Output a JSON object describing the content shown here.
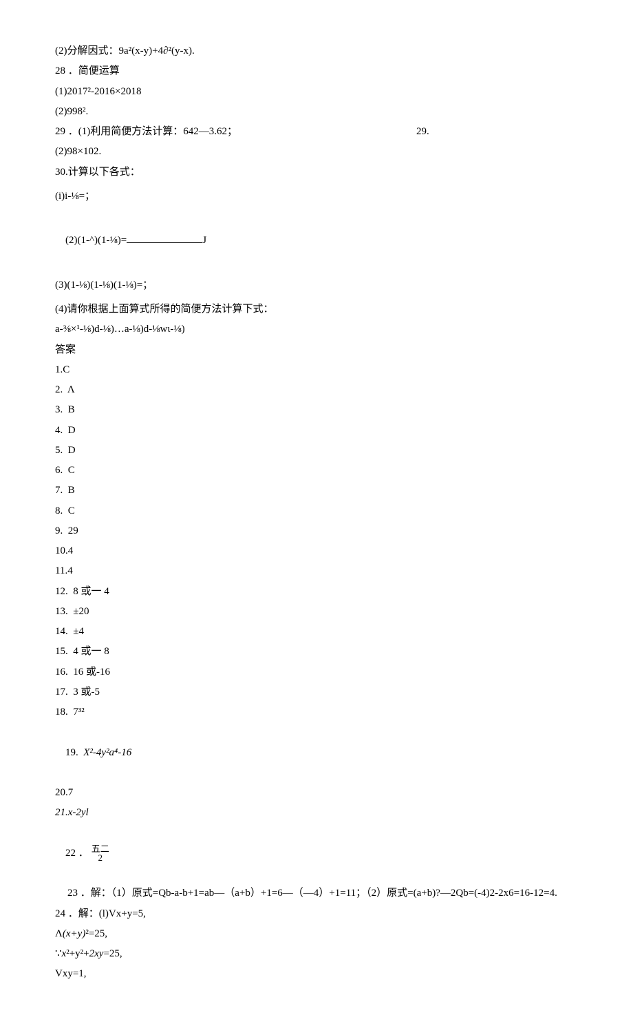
{
  "lines": {
    "l1": "(2)分解因式：9a²(x-y)+4∂²(y-x).",
    "l2": "28 ．简便运算",
    "l3": "(1)2017²-2016×2018",
    "l4": "(2)998².",
    "l5a": "29 ．(1)利用简便方法计算：642—3.62；",
    "l5b": "29.",
    "l6": "(2)98×102.",
    "l7": "30.计算以下各式：",
    "l8": "(i)i-⅛=；",
    "l9a": "(2)(1-^)(1-⅛)=",
    "l9b": "J",
    "l10": "(3)(1-⅛)(1-⅛)(1-⅛)=；",
    "l11": "(4)请你根据上面算式所得的简便方法计算下式：",
    "l12": "a-⅜×¹-⅛)d-⅛)…a-⅛)d-⅛wι-⅛)",
    "l13": "答案",
    "l14": "1.C",
    "l15": "2.  Λ",
    "l16": "3.  B",
    "l17": "4.  D",
    "l18": "5.  D",
    "l19": "6.  C",
    "l20": "7.  B",
    "l21": "8.  C",
    "l22": "9.  29",
    "l23": "10.4",
    "l24": "11.4",
    "l25": "12.  8 或一 4",
    "l26": "13.  ±20",
    "l27": "14.  ±4",
    "l28": "15.  4 或一 8",
    "l29": "16.  16 或-16",
    "l30": "17.  3 或-5",
    "l31": "18.  7³²",
    "l32a": "19.  ",
    "l32b": "X²-4y²a⁴-16",
    "l33": "20.7",
    "l34": "21.x-2yl",
    "l35a": "22 ．",
    "l35b": "五二",
    "l35c": "2",
    "l36": "23 ．解：（1）原式=Qb-a-b+1=ab—（a+b）+1=6—（—4）+1=11；（2）原式=(a+b)?—2Qb=(-4)2-2x6=16-12=4.",
    "l37": "24 ．解：(l)Vx+y=5,",
    "l38": "Λ(x+y)²=25,",
    "l39": "∵x²+y²+2xy=25,",
    "l40": "Vxy=1,"
  }
}
